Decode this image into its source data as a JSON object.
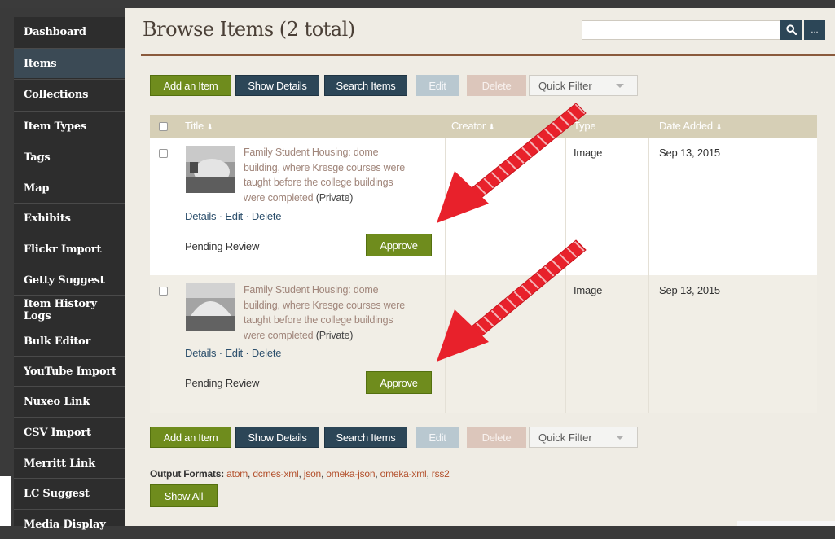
{
  "sidebar": {
    "items": [
      {
        "label": "Dashboard"
      },
      {
        "label": "Items"
      },
      {
        "label": "Collections"
      },
      {
        "label": "Item Types"
      },
      {
        "label": "Tags"
      },
      {
        "label": "Map"
      },
      {
        "label": "Exhibits"
      },
      {
        "label": "Flickr Import"
      },
      {
        "label": "Getty Suggest"
      },
      {
        "label": "Item History Logs"
      },
      {
        "label": "Bulk Editor"
      },
      {
        "label": "YouTube Import"
      },
      {
        "label": "Nuxeo Link"
      },
      {
        "label": "CSV Import"
      },
      {
        "label": "Merritt Link"
      },
      {
        "label": "LC Suggest"
      },
      {
        "label": "Media Display"
      }
    ],
    "active": "Items"
  },
  "header": {
    "title": "Browse Items (2 total)",
    "search_value": "",
    "search_icon": "search-icon",
    "more_label": "..."
  },
  "toolbar": {
    "add_label": "Add an Item",
    "details_label": "Show Details",
    "search_label": "Search Items",
    "edit_label": "Edit",
    "delete_label": "Delete",
    "quick_filter_label": "Quick Filter"
  },
  "table": {
    "columns": [
      {
        "label": "Title",
        "sort_icon": "⬍"
      },
      {
        "label": "Creator",
        "sort_icon": "⬍"
      },
      {
        "label": "Type"
      },
      {
        "label": "Date Added",
        "sort_icon": "⬍"
      }
    ],
    "rows": [
      {
        "title_lines": [
          "Family Student Housing: dome",
          "building, where Kresge courses were",
          "taught before the college buildings",
          "were completed"
        ],
        "visibility": "(Private)",
        "action_details": "Details",
        "action_edit": "Edit",
        "action_delete": "Delete",
        "sep": "·",
        "status": "Pending Review",
        "approve_label": "Approve",
        "creator": "",
        "type": "Image",
        "date_added": "Sep 13, 2015"
      },
      {
        "title_lines": [
          "Family Student Housing: dome",
          "building, where Kresge courses were",
          "taught before the college buildings",
          "were completed"
        ],
        "visibility": "(Private)",
        "action_details": "Details",
        "action_edit": "Edit",
        "action_delete": "Delete",
        "sep": "·",
        "status": "Pending Review",
        "approve_label": "Approve",
        "creator": "",
        "type": "Image",
        "date_added": "Sep 13, 2015"
      }
    ]
  },
  "footer": {
    "output_label": "Output Formats:",
    "formats": [
      "atom",
      "dcmes-xml",
      "json",
      "omeka-json",
      "omeka-xml",
      "rss2"
    ],
    "show_all_label": "Show All"
  },
  "colors": {
    "accent_green": "#6f8c1d",
    "navy": "#2c4657",
    "annotation_red": "#e8212b",
    "title_rule": "#8a5a3c"
  }
}
